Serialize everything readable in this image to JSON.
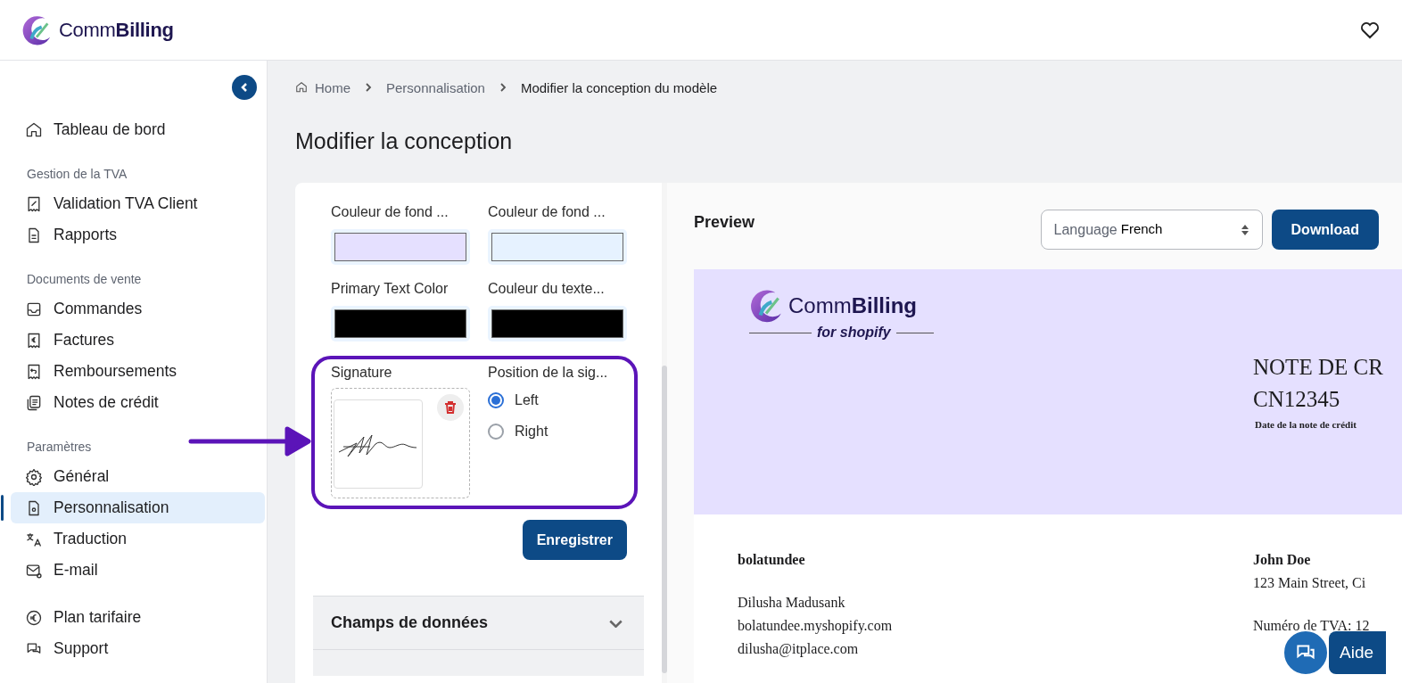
{
  "header": {
    "brand_regular": "Comm",
    "brand_bold": "Billing"
  },
  "sidebar": {
    "groups": [
      {
        "items": [
          {
            "label": "Tableau de bord",
            "kind": "home",
            "selected": false
          }
        ]
      },
      {
        "title": "Gestion de la TVA",
        "items": [
          {
            "label": "Validation TVA Client",
            "kind": "receipt",
            "selected": false
          },
          {
            "label": "Rapports",
            "kind": "doc",
            "selected": false
          }
        ]
      },
      {
        "title": "Documents de vente",
        "items": [
          {
            "label": "Commandes",
            "kind": "inbox",
            "selected": false
          },
          {
            "label": "Factures",
            "kind": "invoice",
            "selected": false
          },
          {
            "label": "Remboursements",
            "kind": "refund",
            "selected": false
          },
          {
            "label": "Notes de crédit",
            "kind": "notes",
            "selected": false
          }
        ]
      },
      {
        "title": "Paramètres",
        "items": [
          {
            "label": "Général",
            "kind": "gear",
            "selected": false
          },
          {
            "label": "Personnalisation",
            "kind": "design",
            "selected": true
          },
          {
            "label": "Traduction",
            "kind": "translate",
            "selected": false
          },
          {
            "label": "E-mail",
            "kind": "mail",
            "selected": false
          }
        ]
      },
      {
        "items": [
          {
            "label": "Plan tarifaire",
            "kind": "euro",
            "selected": false
          },
          {
            "label": "Support",
            "kind": "chat",
            "selected": false
          }
        ]
      }
    ]
  },
  "breadcrumb": [
    "Home",
    "Personnalisation",
    "Modifier la conception du modèle"
  ],
  "page_title": "Modifier la conception",
  "settings": {
    "colors": [
      {
        "label": "Couleur de fond ...",
        "color": "#e5e0ff"
      },
      {
        "label": "Couleur de fond ...",
        "color": "#e6f2ff"
      },
      {
        "label": "Primary Text Color",
        "color": "#000000"
      },
      {
        "label": "Couleur du texte...",
        "color": "#000000"
      }
    ],
    "signature_label": "Signature",
    "position_label": "Position de la sig...",
    "positions": [
      {
        "label": "Left",
        "selected": true
      },
      {
        "label": "Right",
        "selected": false
      }
    ],
    "save": "Enregistrer",
    "accordions": [
      {
        "title": "Champs de données",
        "expanded": false
      }
    ]
  },
  "preview": {
    "title": "Preview",
    "language_label": "Language",
    "language": "French",
    "download": "Download",
    "invoice": {
      "logo_regular": "Comm",
      "logo_bold": "Billing",
      "logo_sub": "for shopify",
      "doc_title": "NOTE DE CR",
      "number": "CN12345",
      "date_label": "Date de la note de crédit",
      "seller": [
        "bolatundee",
        "Dilusha Madusank",
        "bolatundee.myshopify.com",
        "dilusha@itplace.com"
      ],
      "buyer": [
        "John Doe",
        "123 Main Street, Ci",
        "Numéro de TVA: 12"
      ]
    }
  },
  "help": "Aide"
}
